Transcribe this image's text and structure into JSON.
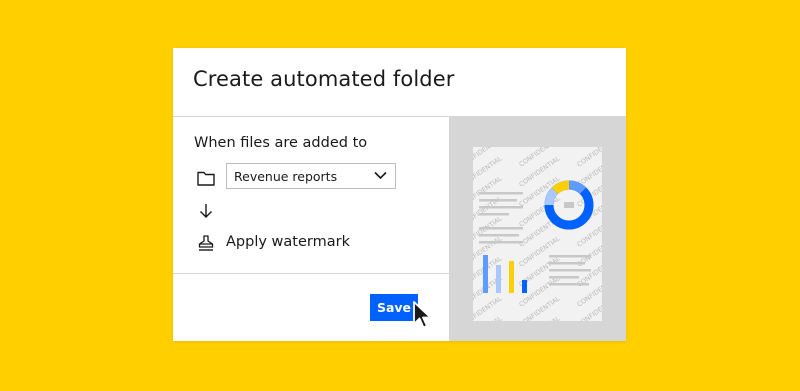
{
  "dialog": {
    "title": "Create automated folder",
    "trigger_label": "When files are added to",
    "folder_select": {
      "value": "Revenue reports"
    },
    "action_label": "Apply watermark",
    "save_label": "Save"
  },
  "preview": {
    "watermark_text": "CONFIDENTIAL"
  },
  "icons": {
    "folder": "folder-icon",
    "select_chevron": "chevron-down-icon",
    "flow_arrow": "arrow-down-icon",
    "watermark": "stamp-icon",
    "cursor": "mouse-pointer-icon"
  },
  "colors": {
    "background": "#FFCF00",
    "primary_button": "#0061FE",
    "preview_backdrop": "#D6D6D6"
  }
}
